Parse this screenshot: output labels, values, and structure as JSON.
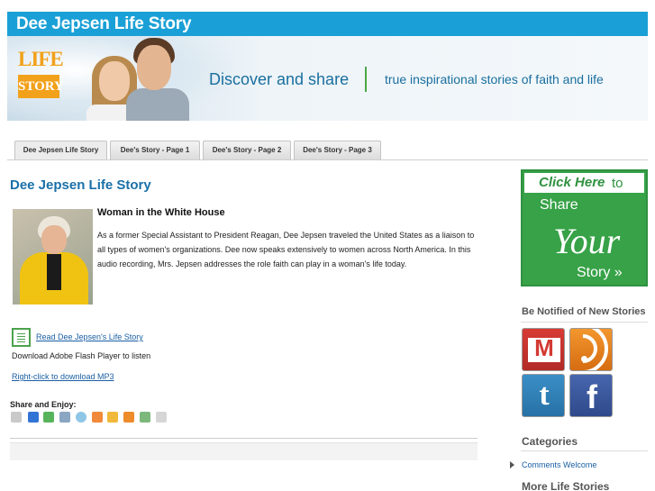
{
  "header": {
    "site_title": "Dee Jepsen Life Story",
    "logo_top": "LIFE",
    "logo_bottom": "STORY",
    "tagline_left": "Discover and share",
    "tagline_right": "true inspirational stories of faith and life"
  },
  "tabs": [
    {
      "label": "Dee Jepsen Life Story"
    },
    {
      "label": "Dee's Story - Page 1"
    },
    {
      "label": "Dee's Story - Page 2"
    },
    {
      "label": "Dee's Story - Page 3"
    }
  ],
  "main": {
    "page_title": "Dee Jepsen Life Story",
    "story_heading": "Woman in the White House",
    "story_text": "As a former Special Assistant to President Reagan, Dee Jepsen traveled the United States as a liaison to all types of women's organizations. Dee now speaks extensively to women across North America. In this audio recording, Mrs. Jepsen addresses the role faith can play in a woman's life today.",
    "read_link": "Read Dee Jepsen's Life Story",
    "flash_text": "Download Adobe Flash Player to listen",
    "mp3_link": "Right-click to download MP3",
    "share_title": "Share and Enjoy:",
    "share_icons": [
      "print-icon",
      "delicious-icon",
      "netvibes-icon",
      "dzone-icon",
      "blinklist-icon",
      "rss-icon",
      "wordpress-icon",
      "blogger-icon",
      "newsvine-icon",
      "bird-icon"
    ]
  },
  "sidebar": {
    "cta_click": "Click Here",
    "cta_to": "to",
    "cta_share": "Share",
    "cta_your": "Your",
    "cta_story": "Story »",
    "notify_heading": "Be Notified of New Stories",
    "social_icons": [
      "gmail-icon",
      "rss-icon",
      "twitter-icon",
      "facebook-icon"
    ],
    "categories_heading": "Categories",
    "categories": [
      "Comments Welcome"
    ],
    "more_heading": "More Life Stories"
  },
  "colors": {
    "header_blue": "#1aa0d6",
    "title_blue": "#1a70a8",
    "link_blue": "#1a5fa3",
    "cta_green": "#37a247",
    "logo_orange": "#f2a11b"
  }
}
